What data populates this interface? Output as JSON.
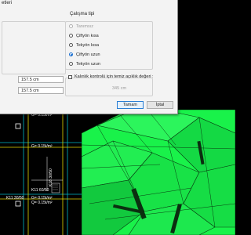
{
  "dialog": {
    "title_fragment": "etleri",
    "group_title": "Çalışma tipi",
    "options": [
      {
        "label": "Tanımsız",
        "state": "disabled"
      },
      {
        "label": "Çiftyön kısa",
        "state": "normal"
      },
      {
        "label": "Tekyön kısa",
        "state": "normal"
      },
      {
        "label": "Çiftyön uzun",
        "state": "checked"
      },
      {
        "label": "Tekyön uzun",
        "state": "normal"
      }
    ],
    "input_1": "157.5 cm",
    "input_2": "157.5 cm",
    "checkbox_label": "Kalınlık kontrolü için temiz açıklık değeri :",
    "clear_span_value": "345 cm",
    "ok_label": "Tamam",
    "cancel_label": "İptal"
  },
  "plan": {
    "load_label_1": "G= 0.15t/m²",
    "load_label_2": "G= 0.15t/m²",
    "load_label_3": "G= 0.15t/m²",
    "load_label_4": "Q= 0.15t/m²",
    "beam_label_1": "K11 60/50",
    "beam_label_2": "K11 30/50",
    "column_label": "K18 30/50"
  },
  "colors": {
    "model_green": "#19f24a",
    "grid_cyan": "#00b7c4",
    "grid_yellow": "#e0d600",
    "dialog_bg": "#f3f3f3",
    "accent": "#1a6fd0"
  }
}
